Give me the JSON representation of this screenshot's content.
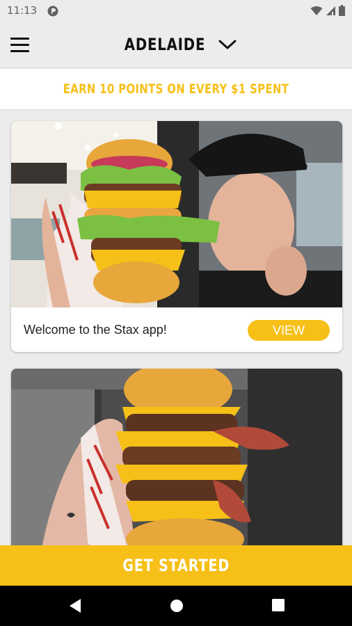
{
  "status_bar": {
    "time": "11:13",
    "icons": [
      "app-notification-icon",
      "wifi-icon",
      "cell-signal-icon",
      "battery-icon"
    ]
  },
  "header": {
    "menu_icon": "hamburger-menu-icon",
    "location": "ADELAIDE",
    "dropdown_icon": "chevron-down-icon"
  },
  "promo": {
    "text": "EARN 10 POINTS ON EVERY $1 SPENT"
  },
  "feed": {
    "cards": [
      {
        "title": "Welcome to the Stax app!",
        "button_label": "VIEW",
        "image": "burger-with-man-photo"
      },
      {
        "title": "",
        "image": "stacked-bacon-burger-photo"
      }
    ]
  },
  "cta": {
    "label": "GET STARTED"
  },
  "nav": {
    "icons": [
      "back-icon",
      "home-icon",
      "recents-icon"
    ]
  },
  "colors": {
    "accent": "#f6c018",
    "background": "#ececec",
    "nav": "#000000"
  }
}
